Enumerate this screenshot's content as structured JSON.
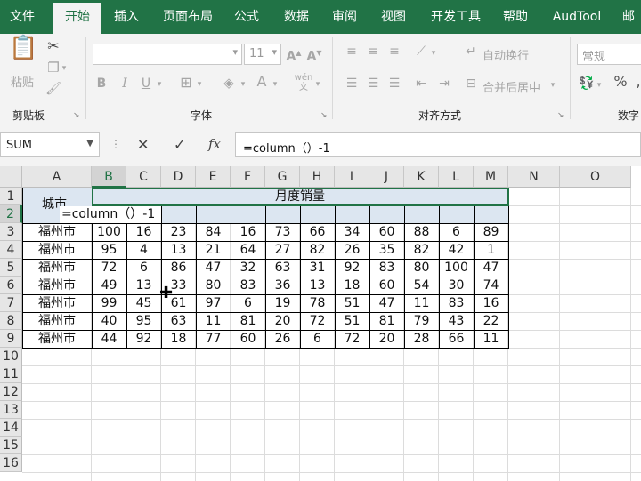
{
  "tabs": [
    "文件",
    "开始",
    "插入",
    "页面布局",
    "公式",
    "数据",
    "审阅",
    "视图",
    "开发工具",
    "帮助",
    "AudTool",
    "邮"
  ],
  "ribbon": {
    "clipboard": {
      "paste_label": "粘贴",
      "group_label": "剪贴板"
    },
    "font": {
      "font_name": "",
      "font_size": "11",
      "group_label": "字体"
    },
    "alignment": {
      "wrap_label": "自动换行",
      "merge_label": "合并后居中",
      "group_label": "对齐方式"
    },
    "number": {
      "format_value": "常规",
      "group_label": "数字"
    }
  },
  "formula_bar": {
    "name_box": "SUM",
    "cancel": "✕",
    "enter": "✓",
    "fx": "fx",
    "formula": "=column（）-1"
  },
  "columns": [
    "A",
    "B",
    "C",
    "D",
    "E",
    "F",
    "G",
    "H",
    "I",
    "J",
    "K",
    "L",
    "M",
    "N",
    "O"
  ],
  "rows": [
    "1",
    "2",
    "3",
    "4",
    "5",
    "6",
    "7",
    "8",
    "9",
    "10",
    "11",
    "12",
    "13",
    "14",
    "15",
    "16"
  ],
  "sheet": {
    "header_city": "城市",
    "header_sales": "月度销量",
    "editing_text": "=column（）-1",
    "data": [
      [
        "福州市",
        "100",
        "16",
        "23",
        "84",
        "16",
        "73",
        "66",
        "34",
        "60",
        "88",
        "6",
        "89"
      ],
      [
        "福州市",
        "95",
        "4",
        "13",
        "21",
        "64",
        "27",
        "82",
        "26",
        "35",
        "82",
        "42",
        "1"
      ],
      [
        "福州市",
        "72",
        "6",
        "86",
        "47",
        "32",
        "63",
        "31",
        "92",
        "83",
        "80",
        "100",
        "47"
      ],
      [
        "福州市",
        "49",
        "13",
        "33",
        "80",
        "83",
        "36",
        "13",
        "18",
        "60",
        "54",
        "30",
        "74"
      ],
      [
        "福州市",
        "99",
        "45",
        "61",
        "97",
        "6",
        "19",
        "78",
        "51",
        "47",
        "11",
        "83",
        "16"
      ],
      [
        "福州市",
        "40",
        "95",
        "63",
        "11",
        "81",
        "20",
        "72",
        "51",
        "81",
        "79",
        "43",
        "22"
      ],
      [
        "福州市",
        "44",
        "92",
        "18",
        "77",
        "60",
        "26",
        "6",
        "72",
        "20",
        "28",
        "66",
        "11"
      ]
    ]
  },
  "colors": {
    "brand": "#217346",
    "header_fill": "#dce6f1"
  }
}
